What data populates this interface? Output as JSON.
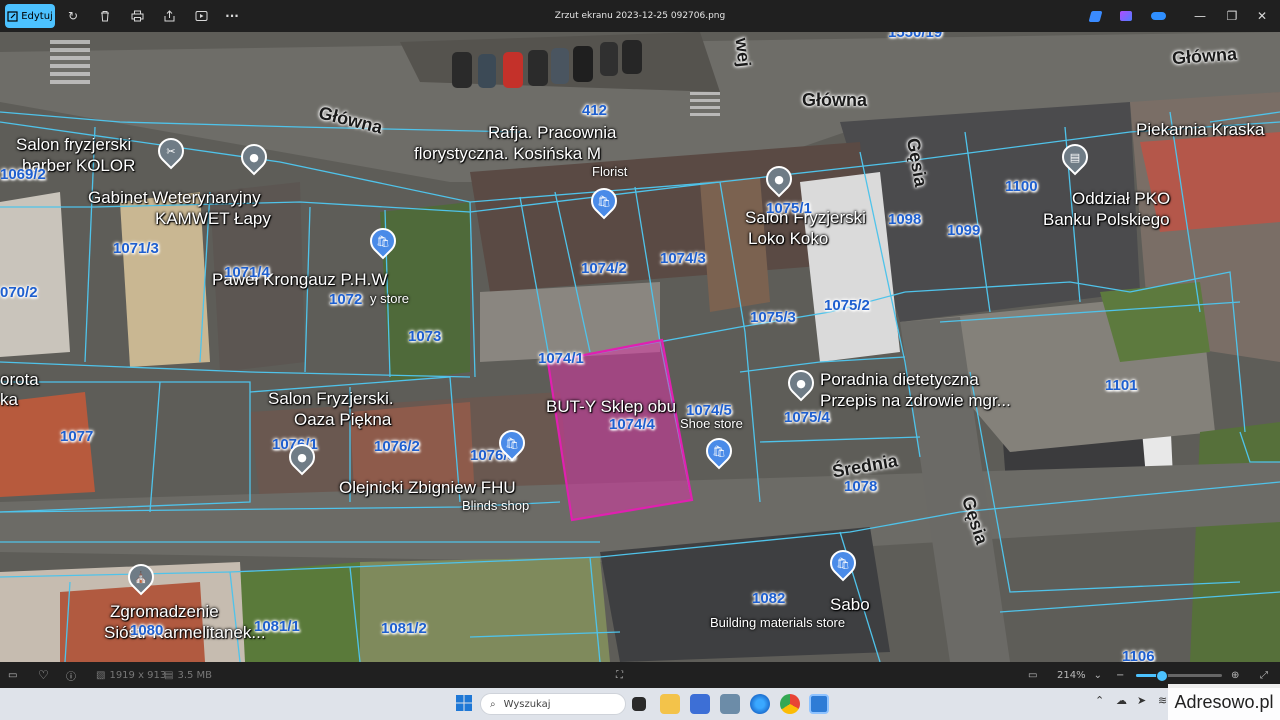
{
  "window": {
    "title": "Zrzut ekranu 2023-12-25 092706.png",
    "edit_label": "Edytuj",
    "toolbar_icons": [
      "rotate-icon",
      "delete-icon",
      "print-icon",
      "share-icon",
      "slideshow-icon",
      "more-icon"
    ],
    "right_icons": [
      "clipchamp-icon",
      "designer-icon",
      "onedrive-icon"
    ]
  },
  "map": {
    "streets": {
      "glowna_1": "Główna",
      "glowna_2": "Główna",
      "glowna_3": "Główna",
      "gesia_1": "Gęsia",
      "gesia_2": "Gęsia",
      "srednia": "Średnia",
      "wej": "wej"
    },
    "places": {
      "barber": "Salon fryzjerski",
      "barber_2": "barber KOLOR",
      "vet_1": "Gabinet Weterynaryjny",
      "vet_2": "KAMWET Łapy",
      "rafja_1": "Rafja. Pracownia",
      "rafja_2": "florystyczna. Kosińska M",
      "rafja_sub": "Florist",
      "pawel": "Paweł Krongauz P.H.W",
      "pawel_sub": "y store",
      "loko_1": "Salon Fryzjerski",
      "loko_2": "Loko Koko",
      "piekarnia": "Piekarnia Kraska",
      "pko_1": "Oddział PKO",
      "pko_2": "Banku Polskiego",
      "poradnia_1": "Poradnia dietetyczna",
      "poradnia_2": "Przepis na zdrowie mgr...",
      "oaza_1": "Salon Fryzjerski.",
      "oaza_2": "Oaza Piękna",
      "buty_1": "BUT-Y Sklep obu",
      "buty_sub": "Shoe store",
      "olejnicki": "Olejnicki Zbigniew FHU",
      "olejnicki_sub": "Blinds shop",
      "dorota_1": "orota",
      "dorota_2": "ka",
      "zgrom_1": "Zgromadzenie",
      "zgrom_2": "Sióstr Karmelitanek...",
      "sabo": "Sabo",
      "sabo_sub": "Building materials store"
    },
    "parcels": {
      "p412": "412",
      "p1069_2": "1069/2",
      "p1070_2": "070/2",
      "p1071_3": "1071/3",
      "p1071_4": "1071/4",
      "p1072": "1072",
      "p1073": "1073",
      "p1074_1": "1074/1",
      "p1074_2": "1074/2",
      "p1074_3": "1074/3",
      "p1074_4": "1074/4",
      "p1074_5": "1074/5",
      "p1075_1": "1075/1",
      "p1075_2": "1075/2",
      "p1075_3": "1075/3",
      "p1075_4": "1075/4",
      "p1076_1": "1076/1",
      "p1076_2": "1076/2",
      "p1076_3": "1076/3",
      "p1077": "1077",
      "p1078": "1078",
      "p1080": "1080",
      "p1081_1": "1081/1",
      "p1081_2": "1081/2",
      "p1082": "1082",
      "p1098": "1098",
      "p1099": "1099",
      "p1100": "1100",
      "p1101": "1101",
      "p1106": "1106",
      "p1550_19": "1550/19"
    }
  },
  "status": {
    "dimensions": "1919 x 913",
    "filesize": "3.5 MB",
    "zoom": "214%"
  },
  "taskbar": {
    "search_placeholder": "Wyszukaj"
  },
  "watermark": "Adresowo.pl"
}
